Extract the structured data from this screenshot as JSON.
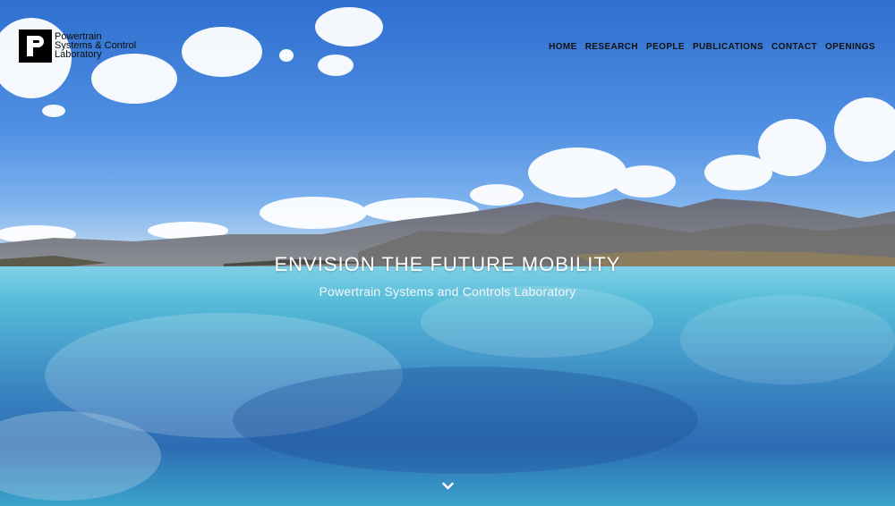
{
  "brand": {
    "logo_letter": "P",
    "name_lines": [
      "Powertrain",
      "Systems & Control",
      "Laboratory"
    ]
  },
  "nav": {
    "items": [
      "HOME",
      "RESEARCH",
      "PEOPLE",
      "PUBLICATIONS",
      "CONTACT",
      "OPENINGS"
    ]
  },
  "hero": {
    "headline": "ENVISION THE FUTURE MOBILITY",
    "subheadline": "Powertrain Systems and Controls Laboratory",
    "scroll_icon": "chevron-down-icon"
  },
  "colors": {
    "sky_top": "#2f6fd0",
    "water": "#4fb7d6",
    "text_light": "#ffffff",
    "text_dark": "#111111"
  }
}
